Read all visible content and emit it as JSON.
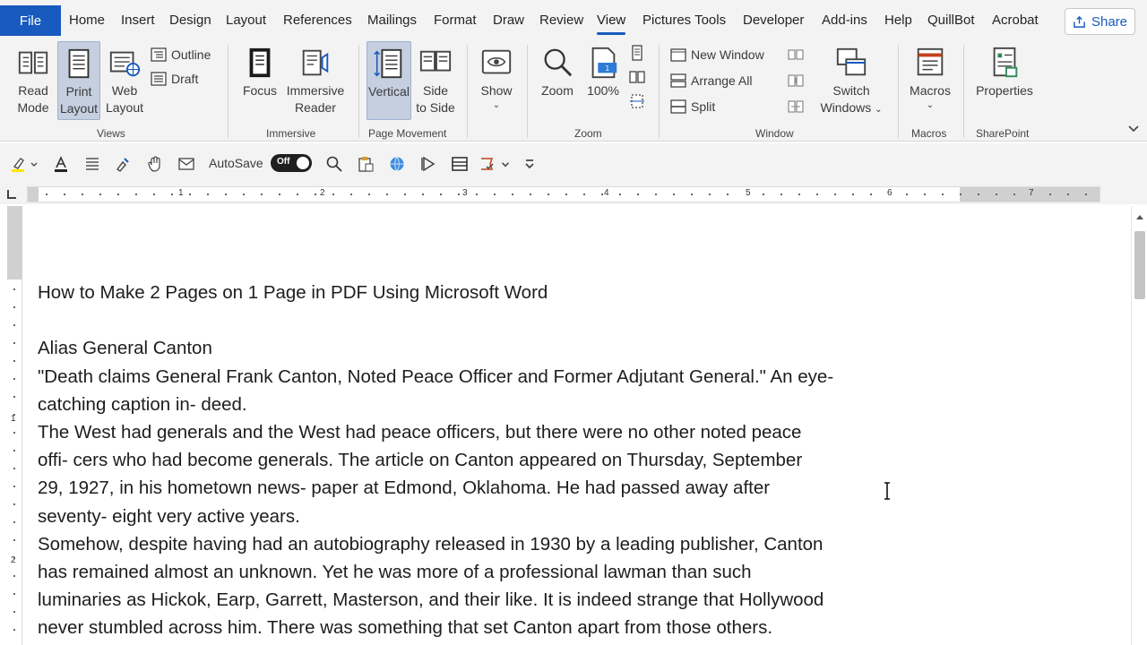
{
  "tabs": {
    "file": "File",
    "items": [
      "Home",
      "Insert",
      "Design",
      "Layout",
      "References",
      "Mailings",
      "Format",
      "Draw",
      "Review",
      "View",
      "Pictures Tools",
      "Developer",
      "Add-ins",
      "Help",
      "QuillBot",
      "Acrobat"
    ],
    "active": "View",
    "share": "Share"
  },
  "ribbon": {
    "views": {
      "label": "Views",
      "read_mode": [
        "Read",
        "Mode"
      ],
      "print_layout": [
        "Print",
        "Layout"
      ],
      "web_layout": [
        "Web",
        "Layout"
      ],
      "outline": "Outline",
      "draft": "Draft"
    },
    "immersive": {
      "label": "Immersive",
      "focus": "Focus",
      "immersive_reader": [
        "Immersive",
        "Reader"
      ]
    },
    "page_movement": {
      "label": "Page Movement",
      "vertical": "Vertical",
      "side_to_side": [
        "Side",
        "to Side"
      ]
    },
    "show": {
      "label": "Show"
    },
    "zoom": {
      "label": "Zoom",
      "zoom": "Zoom",
      "hundred": "100%"
    },
    "window": {
      "label": "Window",
      "new_window": "New Window",
      "arrange_all": "Arrange All",
      "split": "Split",
      "switch_windows": [
        "Switch",
        "Windows"
      ]
    },
    "macros": {
      "label": "Macros",
      "macros": "Macros"
    },
    "sharepoint": {
      "label": "SharePoint",
      "properties": "Properties"
    }
  },
  "qat": {
    "autosave": "AutoSave",
    "toggle_state": "Off"
  },
  "ruler": {
    "numbers": [
      "1",
      "2",
      "3",
      "4",
      "5",
      "6",
      "7"
    ]
  },
  "vruler": {
    "numbers": [
      "1",
      "2"
    ]
  },
  "document": {
    "title": "How to Make 2 Pages on 1 Page in PDF Using Microsoft Word",
    "lines": [
      "Alias General Canton",
      "\"Death claims General Frank Canton, Noted Peace Officer and Former Adjutant General.\" An eye-",
      "catching caption in- deed.",
      "The West had generals and the West had peace officers, but there were no other noted peace",
      "offi- cers who had become generals. The article on Canton appeared on Thursday, September",
      "29, 1927, in his hometown news- paper at Edmond, Oklahoma. He had passed away after",
      "seventy- eight very active years.",
      "Somehow, despite having had an autobiography released in 1930 by a leading publisher, Canton",
      "has remained almost an unknown. Yet he was more of a professional lawman than such",
      "luminaries as Hickok, Earp, Garrett, Masterson, and their like. It is indeed strange that Hollywood",
      "never stumbled across him. There was something that set Canton apart from those others."
    ]
  },
  "colors": {
    "accent": "#185abd",
    "ribbon_bg": "#f3f3f3",
    "selected": "#c5cfe0"
  }
}
